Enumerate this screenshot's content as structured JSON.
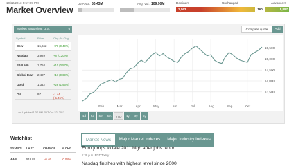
{
  "header": {
    "timestamp": "10/22/2013 5:57:09 PM",
    "title": "Market Overview",
    "dija_vol_label": "DJIA Vol:",
    "dija_vol_value": "50.43M",
    "dija_vol_fill": 0.12,
    "avg_vol_label": "Avg. Vol:",
    "avg_vol_value": "109.90M",
    "avg_vol_fill": 0.28,
    "decliners_label": "Decliners",
    "unchanged_label": "Unchanged",
    "advancers_label": "Advancers",
    "decliners_value": "2,063",
    "unchanged_value": "160",
    "advancers_value": "5,987"
  },
  "market_panel": {
    "snapshot_label": "Market Snapshot: U.S.",
    "compare_label": "Compare quote",
    "add_label": "Add",
    "col_symbol": "Symbol",
    "col_price": "Price",
    "col_chg": "Chg (% Chg)",
    "indices": [
      {
        "symbol": "Dow",
        "price": "15,662",
        "chg": "+76 (0.49%)"
      },
      {
        "symbol": "Nasdaq",
        "price": "3,929",
        "chg": "+8 (0.20%)"
      },
      {
        "symbol": "S&P 500",
        "price": "1,754",
        "chg": "+10 (0.57%)"
      },
      {
        "symbol": "Global Dow",
        "price": "2,427",
        "chg": "+17 (0.69%)"
      },
      {
        "symbol": "Gold",
        "price": "1,342",
        "chg": "+26 (1.96%)"
      },
      {
        "symbol": "Oil",
        "price": "97",
        "chg": "-1.44 (-1.45%)"
      }
    ],
    "last_updated": "Last Updated 1:37 PM EDT Oct 22, 2013",
    "ranges": [
      "1d",
      "5d",
      "6m",
      "6m",
      "YTD",
      "1y",
      "3y",
      "5y"
    ],
    "active_range": 4
  },
  "chart_data": {
    "type": "line",
    "x_labels": [
      "Feb",
      "Mar",
      "Apr",
      "May",
      "Jun",
      "Jul",
      "Aug",
      "Sep",
      "Oct"
    ],
    "y_ticks": [
      13500,
      14000,
      14500,
      15000,
      15500
    ],
    "y_tick_labels": [
      "13,500",
      "14,000",
      "14,500",
      "15,000",
      "15,500"
    ],
    "ylim": [
      13050,
      15900
    ],
    "x_range": [
      0,
      9.8
    ],
    "x": [
      0,
      0.2,
      0.4,
      0.6,
      0.8,
      1.0,
      1.2,
      1.4,
      1.6,
      1.8,
      2.0,
      2.2,
      2.4,
      2.6,
      2.8,
      3.0,
      3.2,
      3.4,
      3.6,
      3.8,
      4.0,
      4.2,
      4.4,
      4.6,
      4.8,
      5.0,
      5.2,
      5.4,
      5.6,
      5.8,
      6.0,
      6.2,
      6.4,
      6.6,
      6.8,
      7.0,
      7.2,
      7.4,
      7.6,
      7.8,
      8.0,
      8.2,
      8.4,
      8.6,
      8.8,
      9.0,
      9.2,
      9.4,
      9.6,
      9.8
    ],
    "y": [
      13080,
      13200,
      13400,
      13480,
      13650,
      13850,
      13920,
      14000,
      14060,
      13950,
      14080,
      14120,
      14380,
      14550,
      14600,
      14800,
      14950,
      14850,
      15000,
      15200,
      15300,
      15150,
      15250,
      15100,
      15000,
      14900,
      14850,
      15100,
      15250,
      15350,
      15500,
      15600,
      15450,
      15300,
      15150,
      15200,
      14950,
      14850,
      14800,
      15100,
      15300,
      15200,
      15050,
      14950,
      14900,
      14850,
      15200,
      15300,
      15400,
      15550
    ],
    "grid": true
  },
  "watchlist": {
    "title": "Watchlist",
    "col_symbol": "SYMBOL",
    "col_last": "LAST",
    "col_change": "CHANGE",
    "col_pct": "% CHG",
    "rows": [
      {
        "symbol": "AAPL",
        "last": "518.89",
        "change": "-0.46",
        "pct": "-0.08%"
      }
    ]
  },
  "news": {
    "tabs": [
      "Market News",
      "Major Market Indexes",
      "Major Industry Indexes"
    ],
    "headline_1": "Euro jumps to late 2011 high after jobs report",
    "headline_1_time": "1:39 p.m. EDT Today",
    "headline_2": "Nasdaq finishes with highest level since 2000"
  },
  "colors": {
    "accent": "#6a9791",
    "decliners": "#c8402b",
    "unchanged": "#f0b83a",
    "advancers": "#7ab648",
    "line": "#6a9791",
    "up": "#3a9d2e",
    "down": "#c8402b"
  }
}
